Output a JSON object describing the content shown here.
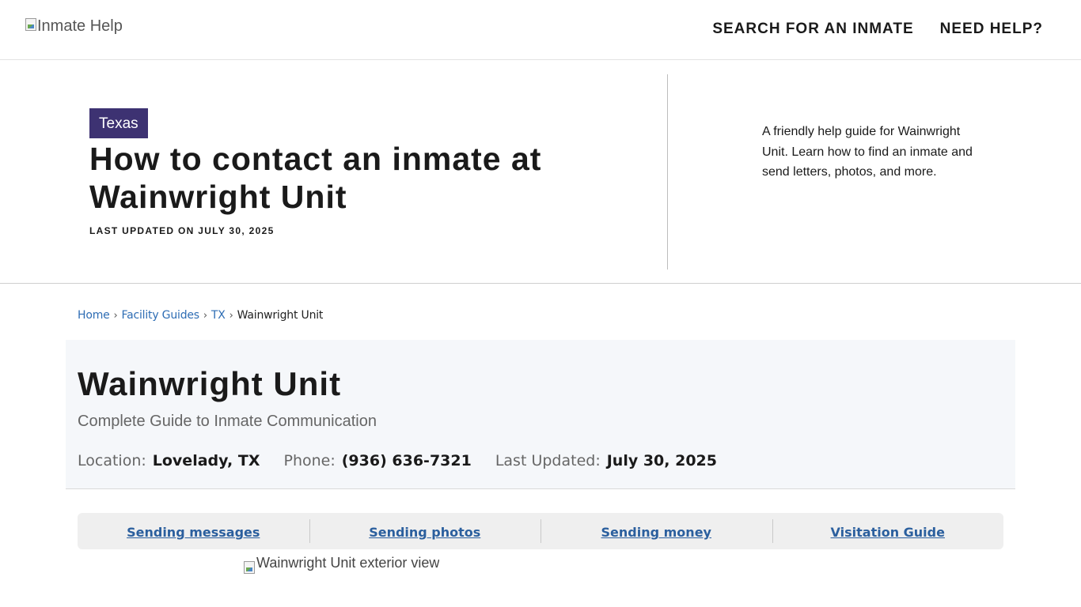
{
  "header": {
    "logo_alt": "Inmate Help",
    "nav": [
      "SEARCH FOR AN INMATE",
      "NEED HELP?"
    ]
  },
  "hero": {
    "badge": "Texas",
    "title": "How to contact an inmate at Wainwright Unit",
    "updated": "LAST UPDATED ON JULY 30, 2025",
    "intro": "A friendly help guide for Wainwright Unit. Learn how to find an inmate and send letters, photos, and more."
  },
  "breadcrumb": {
    "items": [
      "Home",
      "Facility Guides",
      "TX"
    ],
    "current": "Wainwright Unit",
    "separator": "›"
  },
  "facility": {
    "title": "Wainwright Unit",
    "subtitle": "Complete Guide to Inmate Communication",
    "meta": [
      {
        "label": "Location:",
        "value": "Lovelady, TX"
      },
      {
        "label": "Phone:",
        "value": "(936) 636-7321"
      },
      {
        "label": "Last Updated:",
        "value": "July 30, 2025"
      }
    ]
  },
  "tabs": [
    "Sending messages",
    "Sending photos",
    "Sending money",
    "Visitation Guide"
  ],
  "exterior_image_alt": "Wainwright Unit exterior view",
  "colors": {
    "badge_bg": "#3d3272",
    "link": "#2e6db4",
    "tab_link": "#2b5f9e",
    "card_bg": "#f5f7fa"
  }
}
